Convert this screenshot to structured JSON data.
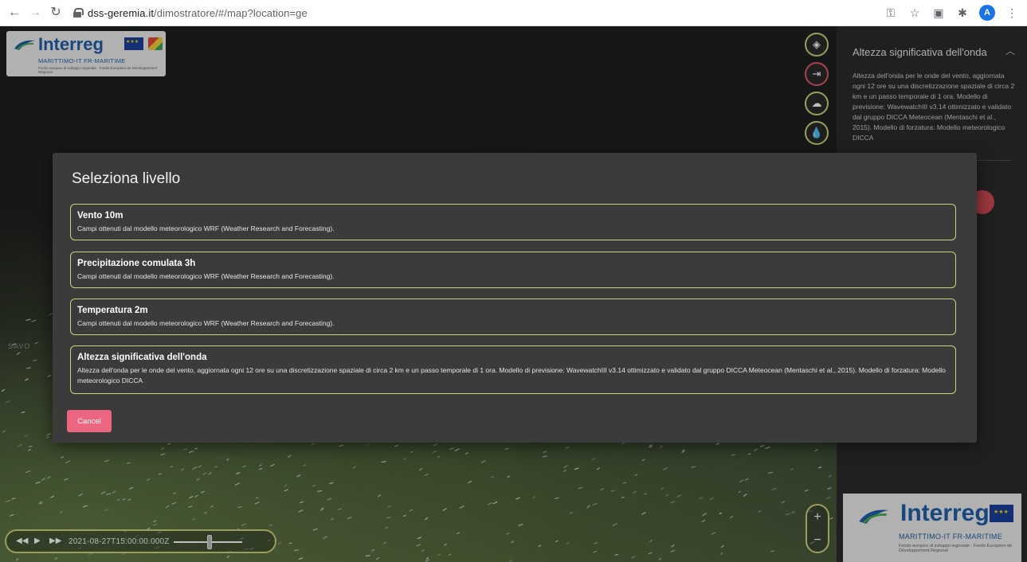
{
  "browser": {
    "url_host": "dss-geremia.it",
    "url_path": "/dimostratore/#/map?location=ge",
    "avatar_initial": "A"
  },
  "map": {
    "place_label": "SAVO",
    "logo": {
      "brand": "Interreg",
      "program": "MARITTIMO-IT FR-MARITIME",
      "fund": "Fondo europeo di sviluppo regionale · Fonds Européen de Développement Régional"
    },
    "timebar": {
      "timestamp": "2021-08-27T15:00:00.000Z",
      "slider_position": 0.52
    },
    "zoom": {
      "in": "+",
      "out": "−"
    },
    "side_buttons": [
      "layers-icon",
      "logout-icon",
      "weather-icon",
      "precipitation-icon"
    ]
  },
  "panel": {
    "title": "Altezza significativa dell'onda",
    "description": "Altezza dell'onda per le onde del vento, aggiornata ogni 12 ore su una discretizzazione spaziale di circa 2 km e un passo temporale di 1 ora. Modello di previsione: WavewatchIII v3.14 ottimizzato e validato dal gruppo DICCA Meteocean (Mentaschi et al., 2015). Modello di forzatura: Modello meteorologico DICCA",
    "logo": {
      "brand": "Interreg",
      "program": "MARITTIMO-IT FR-MARITIME",
      "fund": "Fondo europeo di sviluppo regionale · Fonds Européen de Développement Régional"
    }
  },
  "modal": {
    "title": "Seleziona livello",
    "options": [
      {
        "title": "Vento 10m",
        "description": "Campi ottenuti dal modello meteorologico WRF (Weather Research and Forecasting)."
      },
      {
        "title": "Precipitazione comulata 3h",
        "description": "Campi ottenuti dal modello meteorologico WRF (Weather Research and Forecasting)."
      },
      {
        "title": "Temperatura 2m",
        "description": "Campi ottenuti dal modello meteorologico WRF (Weather Research and Forecasting)."
      },
      {
        "title": "Altezza significativa dell'onda",
        "description": "Altezza dell'onda per le onde del vento, aggiornata ogni 12 ore su una discretizzazione spaziale di circa 2 km e un passo temporale di 1 ora. Modello di previsione: WavewatchIII v3.14 ottimizzato e validato dal gruppo DICCA Meteocean (Mentaschi et al., 2015). Modello di forzatura: Modello meteorologico DICCA"
      }
    ],
    "cancel_label": "Cancel"
  },
  "colors": {
    "accent_border": "#cfd37a",
    "cancel": "#ec6681",
    "modal_bg": "#3b3b3b",
    "brand_blue": "#1f5fa8"
  }
}
